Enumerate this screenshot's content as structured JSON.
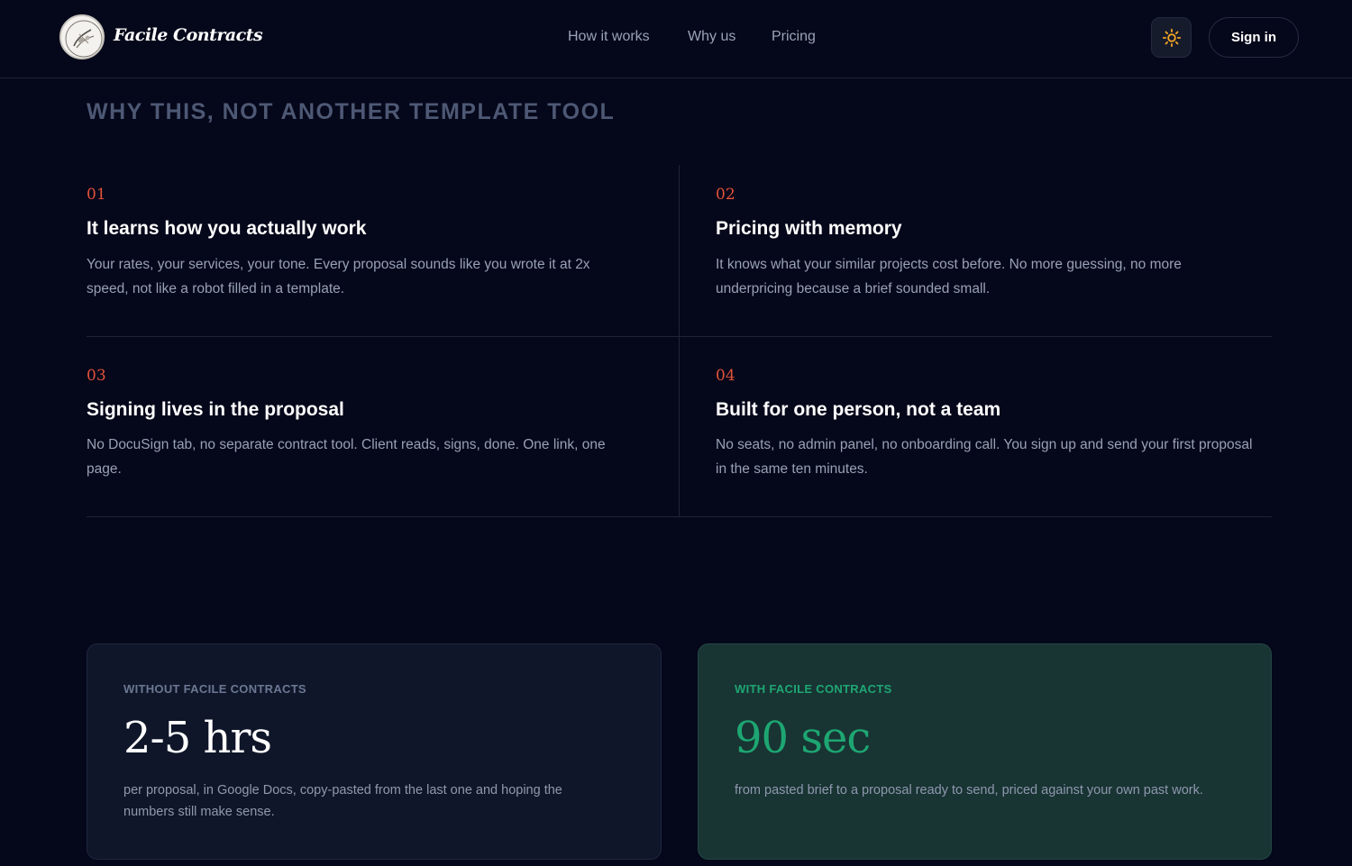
{
  "nav": {
    "brand": "Facile Contracts",
    "links": [
      "How it works",
      "Why us",
      "Pricing"
    ],
    "signin_label": "Sign in",
    "theme_icon": "sun-icon"
  },
  "section": {
    "title": "WHY THIS, NOT ANOTHER TEMPLATE TOOL"
  },
  "features": [
    {
      "num": "01",
      "title": "It learns how you actually work",
      "desc": "Your rates, your services, your tone. Every proposal sounds like you wrote it at 2x speed, not like a robot filled in a template."
    },
    {
      "num": "02",
      "title": "Pricing with memory",
      "desc": "It knows what your similar projects cost before. No more guessing, no more underpricing because a brief sounded small."
    },
    {
      "num": "03",
      "title": "Signing lives in the proposal",
      "desc": "No DocuSign tab, no separate contract tool. Client reads, signs, done. One link, one page."
    },
    {
      "num": "04",
      "title": "Built for one person, not a team",
      "desc": "No seats, no admin panel, no onboarding call. You sign up and send your first proposal in the same ten minutes."
    }
  ],
  "compare": {
    "without": {
      "label": "WITHOUT FACILE CONTRACTS",
      "big": "2-5 hrs",
      "desc": "per proposal, in Google Docs, copy-pasted from the last one and hoping the numbers still make sense."
    },
    "with": {
      "label": "WITH FACILE CONTRACTS",
      "big": "90 sec",
      "desc": "from pasted brief to a proposal ready to send, priced against your own past work."
    }
  },
  "colors": {
    "background": "#05071a",
    "accent_number": "#e2533a",
    "accent_green": "#1ea672",
    "sun": "#f5a524"
  }
}
